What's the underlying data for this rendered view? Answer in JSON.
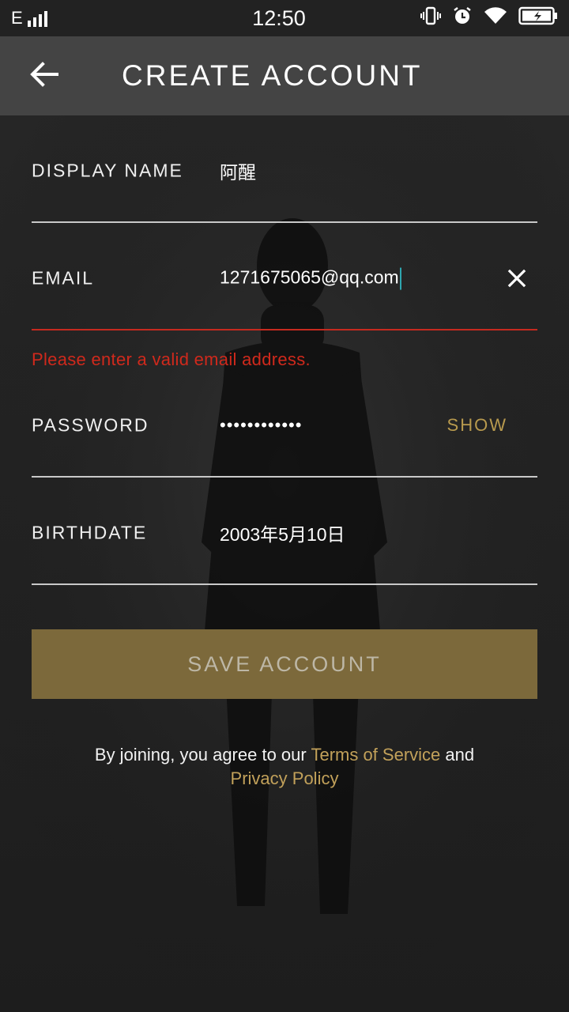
{
  "status_bar": {
    "network": "E",
    "time": "12:50",
    "icons": [
      "vibrate-icon",
      "alarm-icon",
      "wifi-icon",
      "battery-charging-icon"
    ]
  },
  "app_bar": {
    "back_icon": "arrow-left-icon",
    "title": "CREATE ACCOUNT"
  },
  "form": {
    "display_name": {
      "label": "DISPLAY NAME",
      "value": "阿醒"
    },
    "email": {
      "label": "EMAIL",
      "value": "1271675065@qq.com",
      "clear_icon": "close-icon",
      "error": "Please enter a valid email address."
    },
    "password": {
      "label": "PASSWORD",
      "value": "••••••••••••",
      "show_label": "SHOW"
    },
    "birthdate": {
      "label": "BIRTHDATE",
      "value": "2003年5月10日"
    }
  },
  "save_button": "SAVE ACCOUNT",
  "terms": {
    "prefix": "By joining, you agree to our ",
    "tos_link": "Terms of Service",
    "middle": " and",
    "privacy_link": "Privacy Policy"
  },
  "colors": {
    "accent_gold": "#c2a15a",
    "button_bg": "#7c693b",
    "error_red": "#d0291c",
    "app_bar_bg": "#444444"
  }
}
